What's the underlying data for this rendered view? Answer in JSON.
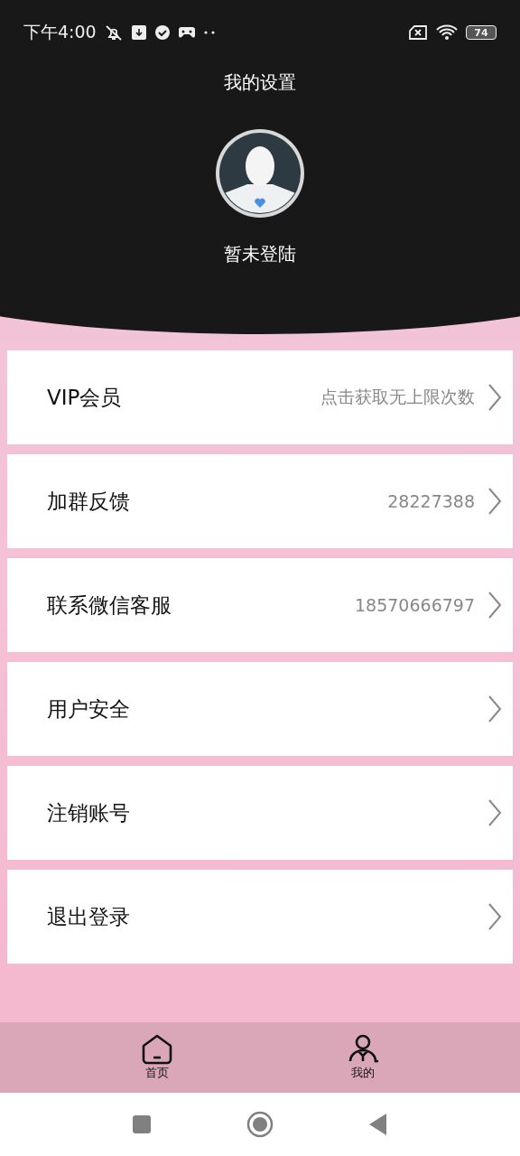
{
  "status_bar": {
    "time": "下午4:00",
    "battery": "74"
  },
  "header": {
    "title": "我的设置",
    "username": "暂未登陆"
  },
  "menu_items": [
    {
      "label": "VIP会员",
      "value": "点击获取无上限次数"
    },
    {
      "label": "加群反馈",
      "value": "28227388"
    },
    {
      "label": "联系微信客服",
      "value": "18570666797"
    },
    {
      "label": "用户安全"
    },
    {
      "label": "注销账号"
    },
    {
      "label": "退出登录"
    }
  ],
  "bottom_nav": [
    {
      "kind": "home",
      "label": "首页"
    },
    {
      "kind": "profile",
      "label": "我的"
    }
  ]
}
